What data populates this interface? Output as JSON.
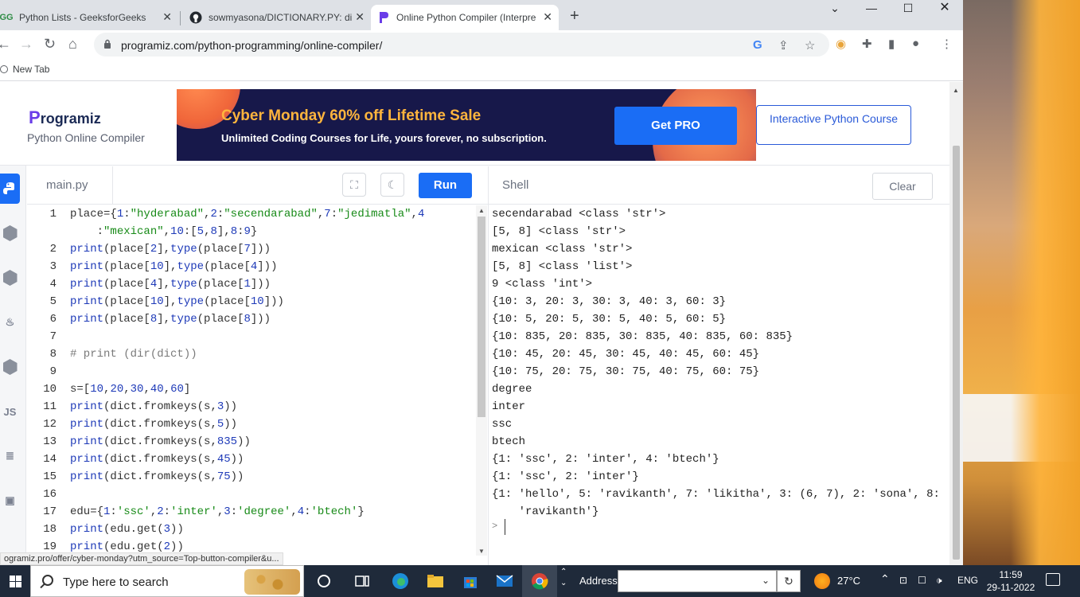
{
  "browser": {
    "tabs": [
      {
        "title": "Python Lists - GeeksforGeeks",
        "favicon": "gfg-icon"
      },
      {
        "title": "sowmyasona/DICTIONARY.PY: di",
        "favicon": "github-icon"
      },
      {
        "title": "Online Python Compiler (Interpre",
        "favicon": "programiz-icon"
      }
    ],
    "url": "programiz.com/python-programming/online-compiler/",
    "bookmark": "New Tab",
    "status_url": "ogramiz.pro/offer/cyber-monday?utm_source=Top-button-compiler&u..."
  },
  "header": {
    "logo": "rogramiz",
    "logo_p": "P",
    "subtitle": "Python Online Compiler",
    "banner_title": "Cyber Monday 60% off Lifetime Sale",
    "banner_sub": "Unlimited Coding Courses for Life, yours forever, no subscription.",
    "banner_cta": "Get PRO",
    "course_btn": "Interactive Python Course"
  },
  "editor": {
    "filename": "main.py",
    "run_label": "Run",
    "lines": [
      {
        "n": "1",
        "t": "place={1:\"hyderabad\",2:\"secendarabad\",7:\"jedimatla\",4"
      },
      {
        "n": "",
        "t": "    :\"mexican\",10:[5,8],8:9}"
      },
      {
        "n": "2",
        "t": "print(place[2],type(place[7]))"
      },
      {
        "n": "3",
        "t": "print(place[10],type(place[4]))"
      },
      {
        "n": "4",
        "t": "print(place[4],type(place[1]))"
      },
      {
        "n": "5",
        "t": "print(place[10],type(place[10]))"
      },
      {
        "n": "6",
        "t": "print(place[8],type(place[8]))"
      },
      {
        "n": "7",
        "t": ""
      },
      {
        "n": "8",
        "t": "# print (dir(dict))"
      },
      {
        "n": "9",
        "t": ""
      },
      {
        "n": "10",
        "t": "s=[10,20,30,40,60]"
      },
      {
        "n": "11",
        "t": "print(dict.fromkeys(s,3))"
      },
      {
        "n": "12",
        "t": "print(dict.fromkeys(s,5))"
      },
      {
        "n": "13",
        "t": "print(dict.fromkeys(s,835))"
      },
      {
        "n": "14",
        "t": "print(dict.fromkeys(s,45))"
      },
      {
        "n": "15",
        "t": "print(dict.fromkeys(s,75))"
      },
      {
        "n": "16",
        "t": ""
      },
      {
        "n": "17",
        "t": "edu={1:'ssc',2:'inter',3:'degree',4:'btech'}"
      },
      {
        "n": "18",
        "t": "print(edu.get(3))"
      },
      {
        "n": "19",
        "t": "print(edu.get(2))"
      }
    ]
  },
  "shell": {
    "title": "Shell",
    "clear_label": "Clear",
    "prompt": ">",
    "lines": [
      "secendarabad <class 'str'>",
      "[5, 8] <class 'str'>",
      "mexican <class 'str'>",
      "[5, 8] <class 'list'>",
      "9 <class 'int'>",
      "{10: 3, 20: 3, 30: 3, 40: 3, 60: 3}",
      "{10: 5, 20: 5, 30: 5, 40: 5, 60: 5}",
      "{10: 835, 20: 835, 30: 835, 40: 835, 60: 835}",
      "{10: 45, 20: 45, 30: 45, 40: 45, 60: 45}",
      "{10: 75, 20: 75, 30: 75, 40: 75, 60: 75}",
      "degree",
      "inter",
      "ssc",
      "btech",
      "{1: 'ssc', 2: 'inter', 4: 'btech'}",
      "{1: 'ssc', 2: 'inter'}",
      "{1: 'hello', 5: 'ravikanth', 7: 'likitha', 3: (6, 7), 2: 'sona', 8:",
      "    'ravikanth'}"
    ]
  },
  "taskbar": {
    "search_placeholder": "Type here to search",
    "address_label": "Address",
    "temperature": "27°C",
    "language": "ENG",
    "time": "11:59",
    "date": "29-11-2022"
  },
  "colors": {
    "accent": "#1a6df5",
    "banner_bg": "#17184a",
    "banner_title": "#ffb53d"
  }
}
